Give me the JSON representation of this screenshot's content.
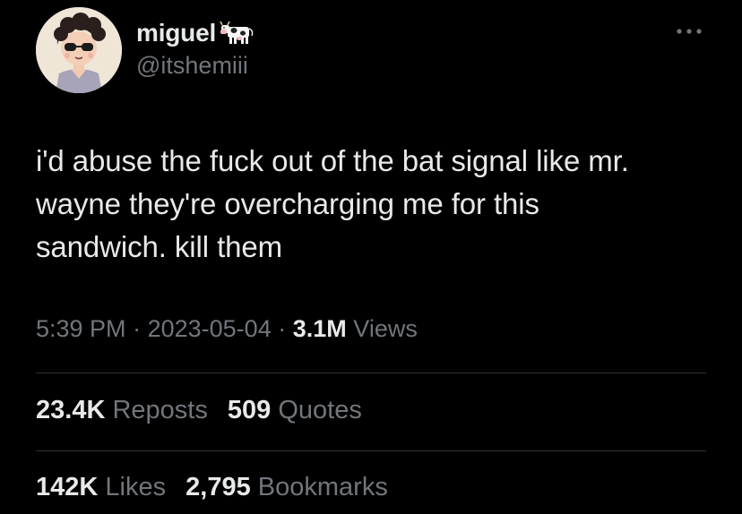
{
  "user": {
    "display_name": "miguel",
    "handle": "@itshemiii",
    "badge_icon": "cow-icon",
    "avatar_icon": "avatar-cartoon-person"
  },
  "menu": {
    "more_icon": "more-horizontal-icon"
  },
  "tweet": {
    "lines": [
      "i'd abuse the fuck out of the bat signal like mr.",
      "wayne they're overcharging me for this",
      "sandwich. kill them"
    ]
  },
  "meta": {
    "time": "5:39 PM",
    "separator": "·",
    "date": "2023-05-04",
    "views_count": "3.1M",
    "views_label": "Views"
  },
  "stats": {
    "reposts_count": "23.4K",
    "reposts_label": "Reposts",
    "quotes_count": "509",
    "quotes_label": "Quotes",
    "likes_count": "142K",
    "likes_label": "Likes",
    "bookmarks_count": "2,795",
    "bookmarks_label": "Bookmarks"
  },
  "colors": {
    "background": "#000000",
    "primary_text": "#e7e9ea",
    "secondary_text": "#71767b",
    "divider": "#2f3336"
  }
}
